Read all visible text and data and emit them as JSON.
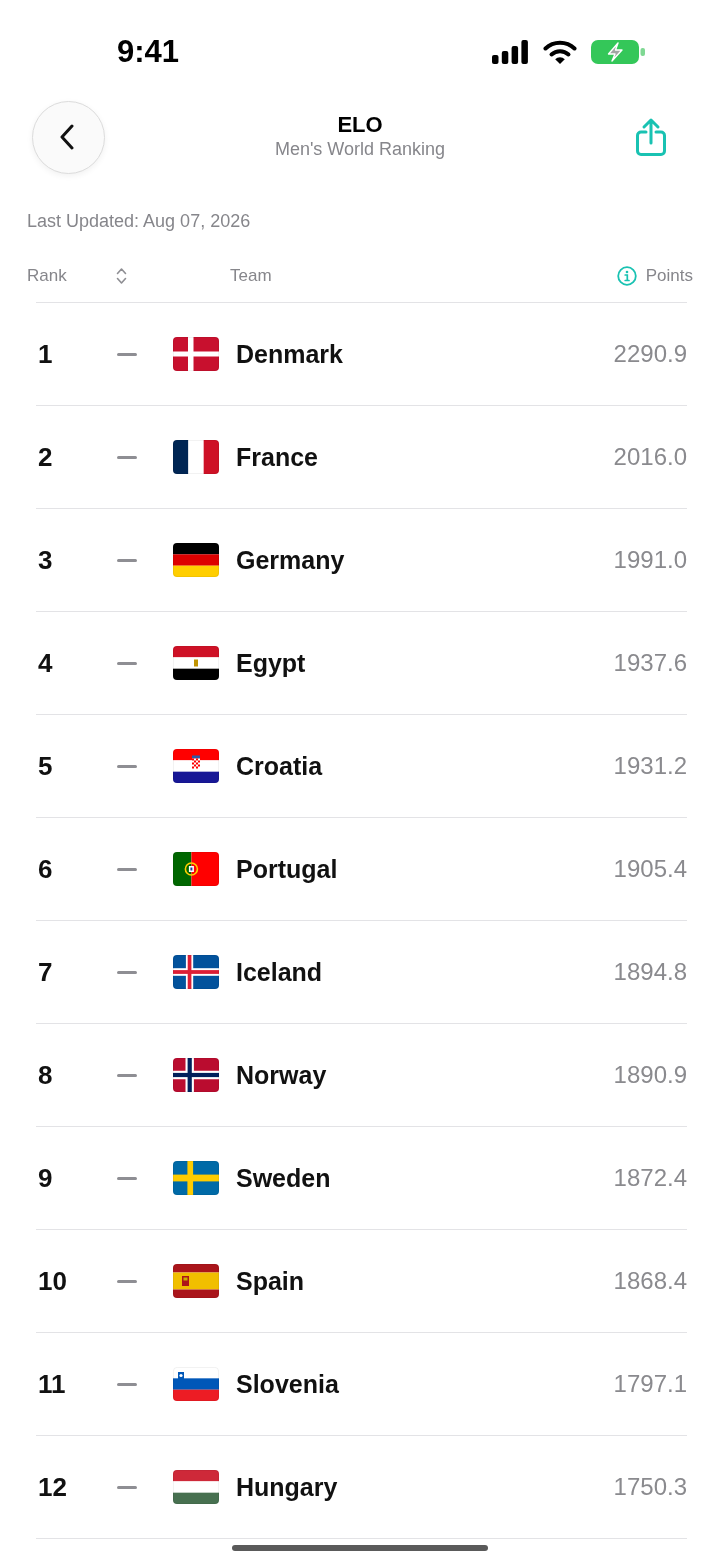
{
  "status_bar": {
    "time": "9:41"
  },
  "header": {
    "title": "ELO",
    "subtitle": "Men's World Ranking"
  },
  "last_updated": "Last Updated: Aug 07, 2026",
  "table": {
    "columns": [
      "Rank",
      "Team",
      "Points"
    ],
    "rows": [
      {
        "rank": "1",
        "unchanged": true,
        "kind": "dk",
        "team": "Denmark",
        "points": "2290.9"
      },
      {
        "rank": "2",
        "unchanged": true,
        "kind": "fr",
        "team": "France",
        "points": "2016.0"
      },
      {
        "rank": "3",
        "unchanged": true,
        "kind": "de",
        "team": "Germany",
        "points": "1991.0"
      },
      {
        "rank": "4",
        "unchanged": true,
        "kind": "eg",
        "team": "Egypt",
        "points": "1937.6"
      },
      {
        "rank": "5",
        "unchanged": true,
        "kind": "hr",
        "team": "Croatia",
        "points": "1931.2"
      },
      {
        "rank": "6",
        "unchanged": true,
        "kind": "pt",
        "team": "Portugal",
        "points": "1905.4"
      },
      {
        "rank": "7",
        "unchanged": true,
        "kind": "is",
        "team": "Iceland",
        "points": "1894.8"
      },
      {
        "rank": "8",
        "unchanged": true,
        "kind": "no",
        "team": "Norway",
        "points": "1890.9"
      },
      {
        "rank": "9",
        "unchanged": true,
        "kind": "se",
        "team": "Sweden",
        "points": "1872.4"
      },
      {
        "rank": "10",
        "unchanged": true,
        "kind": "es",
        "team": "Spain",
        "points": "1868.4"
      },
      {
        "rank": "11",
        "unchanged": true,
        "kind": "si",
        "team": "Slovenia",
        "points": "1797.1"
      },
      {
        "rank": "12",
        "unchanged": true,
        "kind": "hu",
        "team": "Hungary",
        "points": "1750.3"
      }
    ]
  }
}
